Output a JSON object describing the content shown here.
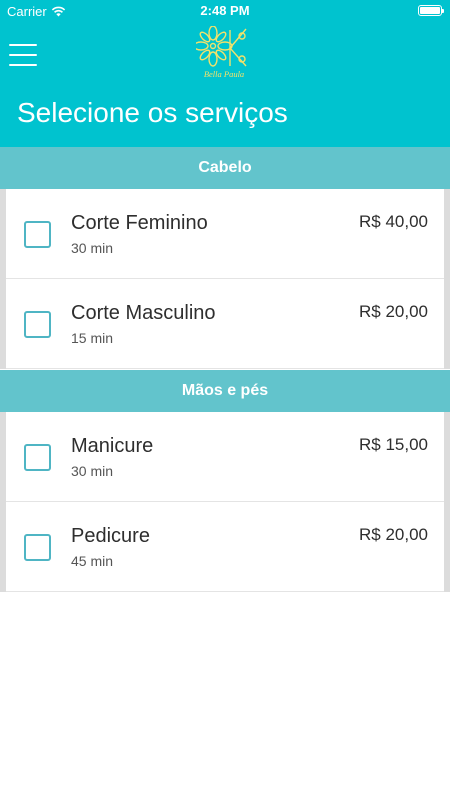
{
  "status_bar": {
    "carrier": "Carrier",
    "time": "2:48 PM"
  },
  "header": {
    "logo_text": "Bella Paula",
    "title": "Selecione os serviços"
  },
  "colors": {
    "header": "#00c3cf",
    "section": "#62c4cc",
    "checkbox_border": "#4fb5c4"
  },
  "sections": [
    {
      "title": "Cabelo",
      "services": [
        {
          "name": "Corte Feminino",
          "duration": "30 min",
          "price": "R$ 40,00",
          "checked": false
        },
        {
          "name": "Corte Masculino",
          "duration": "15 min",
          "price": "R$ 20,00",
          "checked": false
        }
      ]
    },
    {
      "title": "Mãos e pés",
      "services": [
        {
          "name": "Manicure",
          "duration": "30 min",
          "price": "R$ 15,00",
          "checked": false
        },
        {
          "name": "Pedicure",
          "duration": "45 min",
          "price": "R$ 20,00",
          "checked": false
        }
      ]
    }
  ]
}
